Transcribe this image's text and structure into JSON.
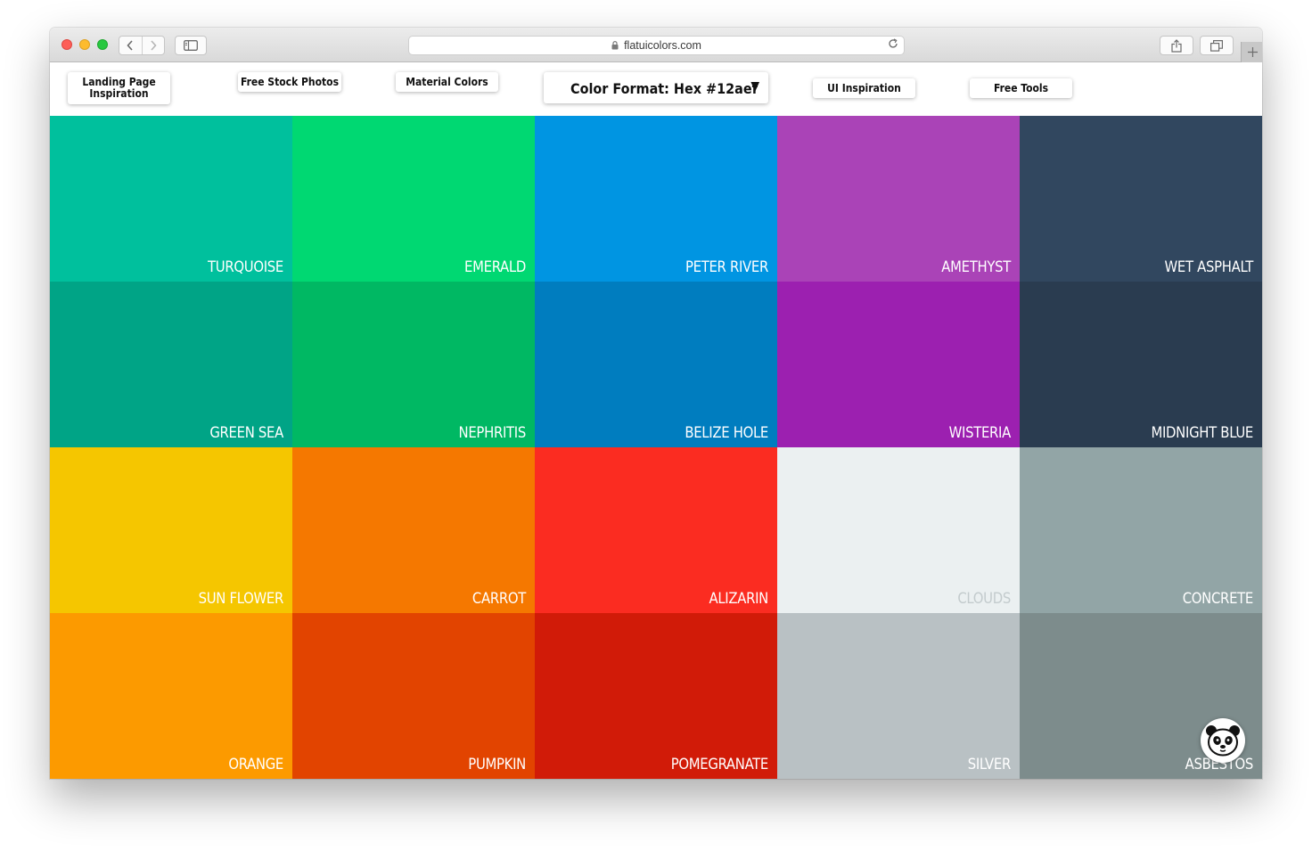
{
  "browser": {
    "url": "flatuicolors.com",
    "share_icon": "share-icon",
    "tabs_icon": "tabs-icon",
    "new_tab_icon": "plus-icon"
  },
  "nav": {
    "landing": "Landing Page\nInspiration",
    "stock": "Free Stock Photos",
    "material": "Material Colors",
    "format": "Color Format: Hex #12aef",
    "format_caret": "▼",
    "ui": "UI Inspiration",
    "tools": "Free Tools"
  },
  "colors": [
    {
      "name": "TURQUOISE",
      "hex": "#1abc9c"
    },
    {
      "name": "EMERALD",
      "hex": "#2ecc71"
    },
    {
      "name": "PETER RIVER",
      "hex": "#3498db"
    },
    {
      "name": "AMETHYST",
      "hex": "#9b59b6"
    },
    {
      "name": "WET ASPHALT",
      "hex": "#34495e"
    },
    {
      "name": "GREEN SEA",
      "hex": "#16a085"
    },
    {
      "name": "NEPHRITIS",
      "hex": "#27ae60"
    },
    {
      "name": "BELIZE HOLE",
      "hex": "#2980b9"
    },
    {
      "name": "WISTERIA",
      "hex": "#8e44ad"
    },
    {
      "name": "MIDNIGHT BLUE",
      "hex": "#2c3e50"
    },
    {
      "name": "SUN FLOWER",
      "hex": "#f1c40f"
    },
    {
      "name": "CARROT",
      "hex": "#e67e22"
    },
    {
      "name": "ALIZARIN",
      "hex": "#e74c3c"
    },
    {
      "name": "CLOUDS",
      "hex": "#ecf0f1"
    },
    {
      "name": "CONCRETE",
      "hex": "#95a5a6"
    },
    {
      "name": "ORANGE",
      "hex": "#f39c12"
    },
    {
      "name": "PUMPKIN",
      "hex": "#d35400"
    },
    {
      "name": "POMEGRANATE",
      "hex": "#c0392b"
    },
    {
      "name": "SILVER",
      "hex": "#bdc3c7"
    },
    {
      "name": "ASBESTOS",
      "hex": "#7f8c8d"
    }
  ],
  "display_colors": [
    "#00c09d",
    "#00d872",
    "#0095e2",
    "#aa43b7",
    "#31475f",
    "#00a486",
    "#00b863",
    "#007dbf",
    "#9c20b0",
    "#2a3c50",
    "#f5c600",
    "#f57800",
    "#fb2c21",
    "#ebf0f1",
    "#92a5a6",
    "#fc9a00",
    "#e24400",
    "#d11b08",
    "#b9c1c4",
    "#7d8c8c"
  ],
  "label_colors": {
    "default": "#ffffff",
    "light": "#c3cbcd"
  },
  "mascot_icon": "panda-icon"
}
